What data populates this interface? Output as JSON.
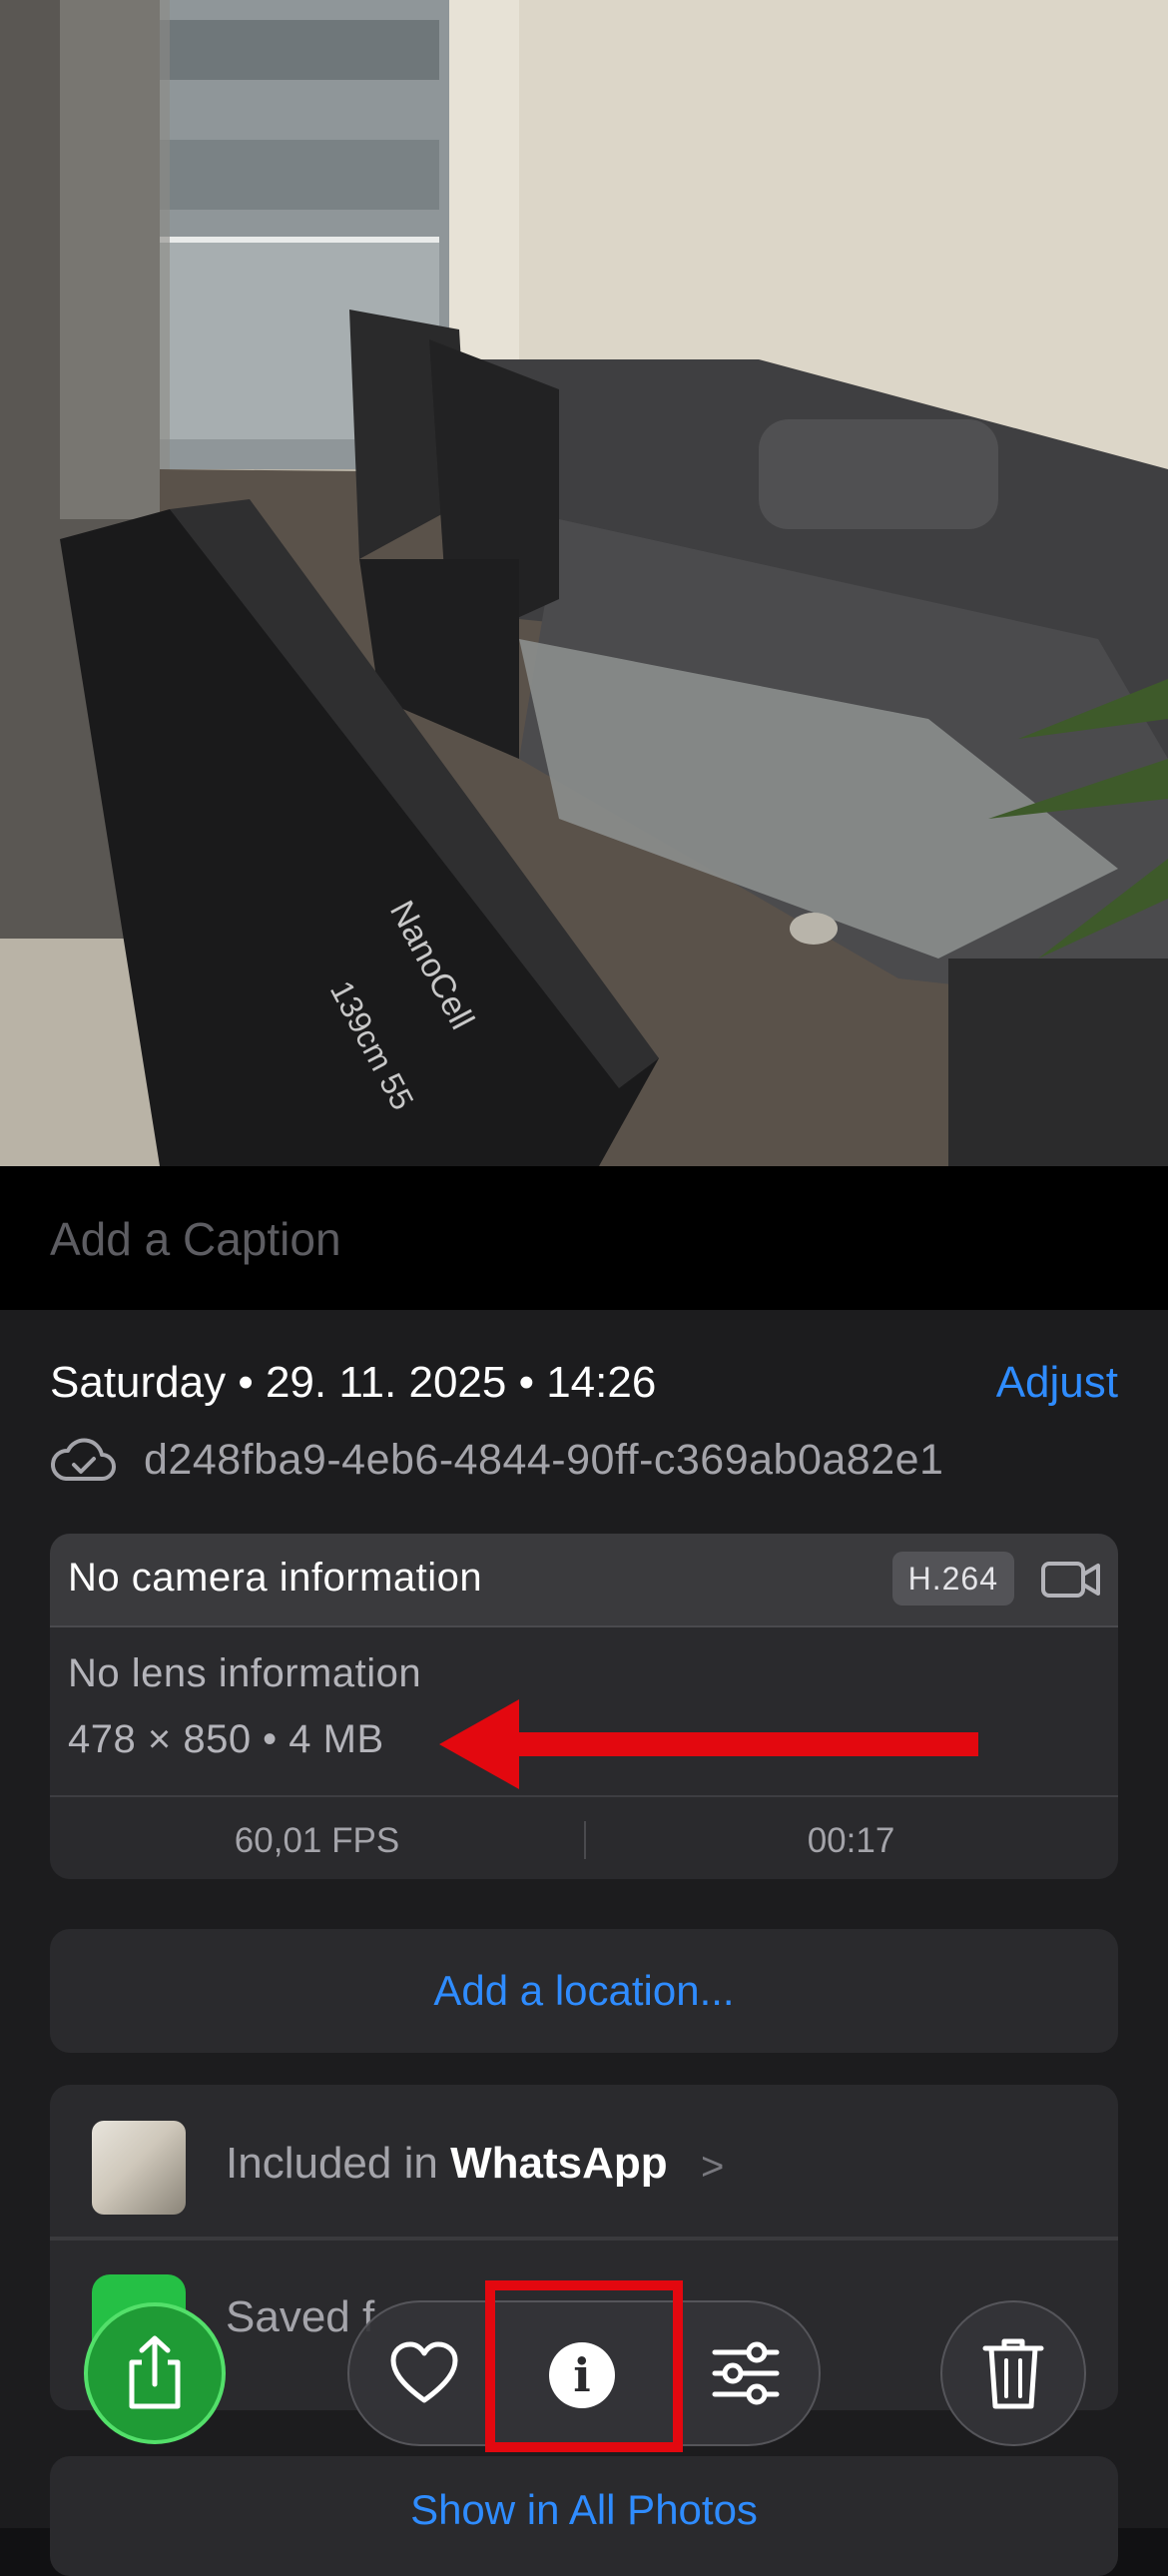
{
  "caption": {
    "placeholder": "Add a Caption"
  },
  "meta": {
    "date_line": "Saturday • 29. 11. 2025 • 14:26",
    "adjust_label": "Adjust",
    "filename": "d248fba9-4eb6-4844-90ff-c369ab0a82e1"
  },
  "camera": {
    "title": "No camera information",
    "codec": "H.264",
    "lens": "No lens information",
    "dimensions": "478 × 850 • 4 MB",
    "fps": "60,01 FPS",
    "duration": "00:17"
  },
  "location": {
    "label": "Add a location..."
  },
  "album": {
    "prefix": "Included in ",
    "name": "WhatsApp",
    "chevron": ">",
    "saved_text": "Saved f"
  },
  "show_all": {
    "label": "Show in All Photos"
  },
  "toolbar": {
    "info_glyph": "i",
    "icons": [
      "share-icon",
      "heart-icon",
      "info-icon",
      "adjust-sliders-icon",
      "trash-icon"
    ]
  },
  "colors": {
    "accent": "#2f8cff",
    "annotation": "#e3080f",
    "share_green": "#1f9b35",
    "background": "#1c1c1e"
  }
}
